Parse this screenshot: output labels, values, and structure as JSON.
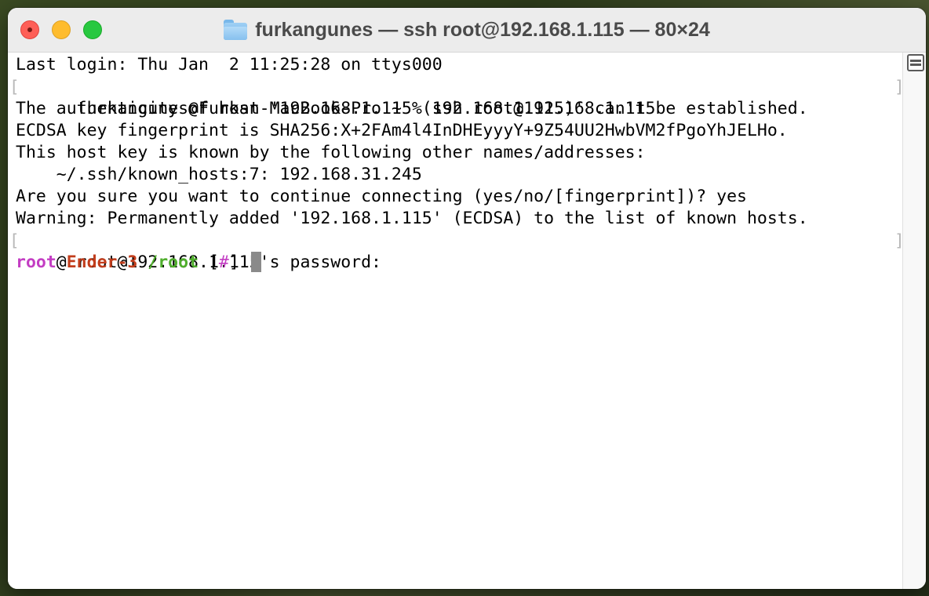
{
  "window": {
    "title": "furkangunes — ssh root@192.168.1.115 — 80×24",
    "title_icon": "folder-icon",
    "buttons": {
      "close": "close-button",
      "minimize": "minimize-button",
      "zoom": "zoom-button"
    }
  },
  "terminal": {
    "lines": [
      "Last login: Thu Jan  2 11:25:28 on ttys000",
      "furkangunes@Furkan-MacBook-Pro ~ % ssh root@192.168.1.115",
      "The authenticity of host '192.168.1.115 (192.168.1.115)' can't be established.",
      "ECDSA key fingerprint is SHA256:X+2FAm4l4InDHEyyyY+9Z54UU2HwbVM2fPgoYhJELHo.",
      "This host key is known by the following other names/addresses:",
      "    ~/.ssh/known_hosts:7: 192.168.31.245",
      "Are you sure you want to continue connecting (yes/no/[fingerprint])? yes",
      "Warning: Permanently added '192.168.1.115' (ECDSA) to the list of known hosts.",
      "root@192.168.1.115's password: "
    ],
    "mark_left": "[",
    "mark_right": "]",
    "prompt": {
      "user": "root",
      "at": "@",
      "host": "Ender-3",
      "dir": " /root",
      "open": " [",
      "hash": "#",
      "close": "] "
    }
  },
  "colors": {
    "prompt_user": "#c33dc3",
    "prompt_host": "#c23d1c",
    "prompt_dir": "#4fae2c",
    "cursor": "#8a8a8a",
    "close_button": "#fe5f57",
    "minimize_button": "#febc2e",
    "zoom_button": "#28c840"
  },
  "scrollbar": {
    "icon": "split-pane-icon"
  }
}
